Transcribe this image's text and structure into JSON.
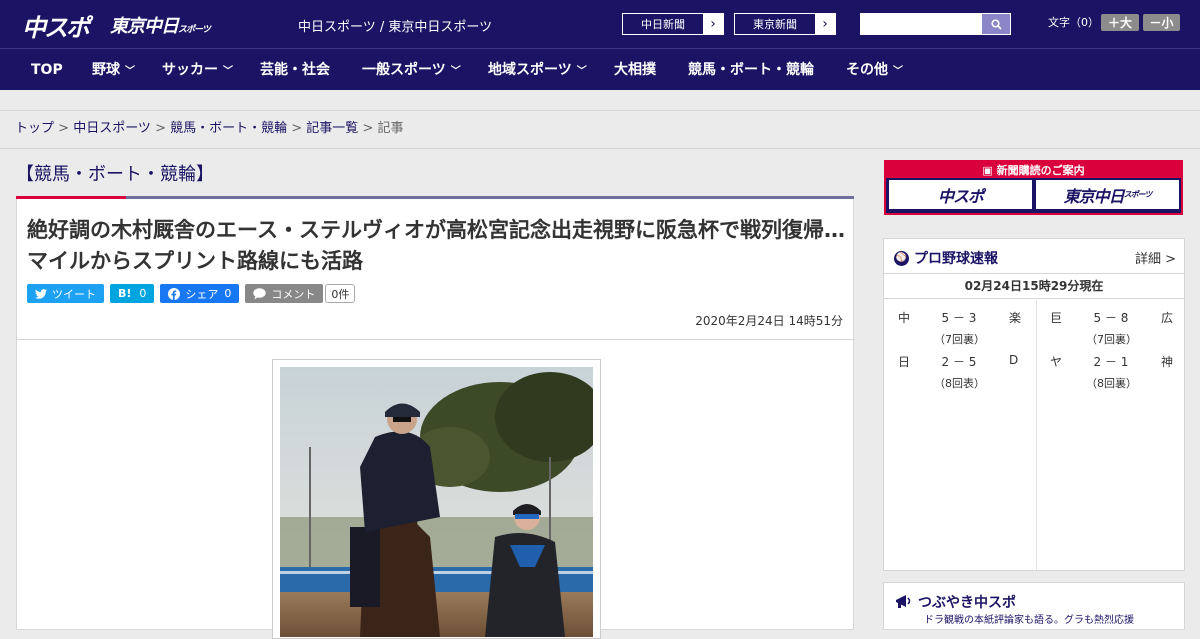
{
  "header": {
    "logo_chuspo": "中スポ",
    "logo_tokyo": "東京中日",
    "logo_tokyo_small": "スポーツ",
    "site_links": "中日スポーツ / 東京中日スポーツ",
    "paper_buttons": [
      "中日新聞",
      "東京新聞"
    ],
    "fontsize_label": "文字（0）",
    "font_bigger": "＋大",
    "font_smaller": "－小"
  },
  "nav": {
    "items": [
      {
        "label": "TOP",
        "dropdown": false
      },
      {
        "label": "野球",
        "dropdown": true
      },
      {
        "label": "サッカー",
        "dropdown": true
      },
      {
        "label": "芸能・社会",
        "dropdown": false
      },
      {
        "label": "一般スポーツ",
        "dropdown": true
      },
      {
        "label": "地域スポーツ",
        "dropdown": true
      },
      {
        "label": "大相撲",
        "dropdown": false
      },
      {
        "label": "競馬・ボート・競輪",
        "dropdown": false
      },
      {
        "label": "その他",
        "dropdown": true
      }
    ]
  },
  "breadcrumb": [
    "トップ",
    "中日スポーツ",
    "競馬・ボート・競輪",
    "記事一覧",
    "記事"
  ],
  "category_title": "【競馬・ボート・競輪】",
  "article": {
    "headline": "絶好調の木村厩舎のエース・ステルヴィオが高松宮記念出走視野に阪急杯で戦列復帰…マイルからスプリント路線にも活路",
    "share": {
      "tweet": "ツイート",
      "hatena": "B!",
      "hatena_count": "0",
      "facebook": "シェア",
      "facebook_count": "0",
      "comment": "コメント",
      "comment_count": "0件"
    },
    "datetime": "2020年2月24日 14時51分"
  },
  "sidebar": {
    "ad": {
      "title": "新聞購読のご案内",
      "left": "中スポ",
      "right": "東京中日",
      "right_small": "スポーツ"
    },
    "baseball": {
      "title": "プロ野球速報",
      "detail": "詳細 >",
      "time": "02月24日15時29分現在",
      "games": [
        {
          "t1": "中",
          "score": "5 － 3",
          "t2": "楽",
          "inning": "（7回裏）"
        },
        {
          "t1": "巨",
          "score": "5 － 8",
          "t2": "広",
          "inning": "（7回裏）"
        },
        {
          "t1": "日",
          "score": "2 － 5",
          "t2": "D",
          "inning": "（8回表）"
        },
        {
          "t1": "ヤ",
          "score": "2 － 1",
          "t2": "神",
          "inning": "（8回裏）"
        }
      ]
    },
    "tweets": {
      "title": "つぶやき中スポ",
      "subtitle": "ドラ観戦の本紙評論家も語る。グラも熱烈応援"
    }
  },
  "colors": {
    "brand_navy": "#1b1464",
    "accent_red": "#d9003b",
    "twitter": "#1da1f2",
    "hatena": "#00a4de",
    "facebook": "#1877f2",
    "comment": "#888888"
  }
}
